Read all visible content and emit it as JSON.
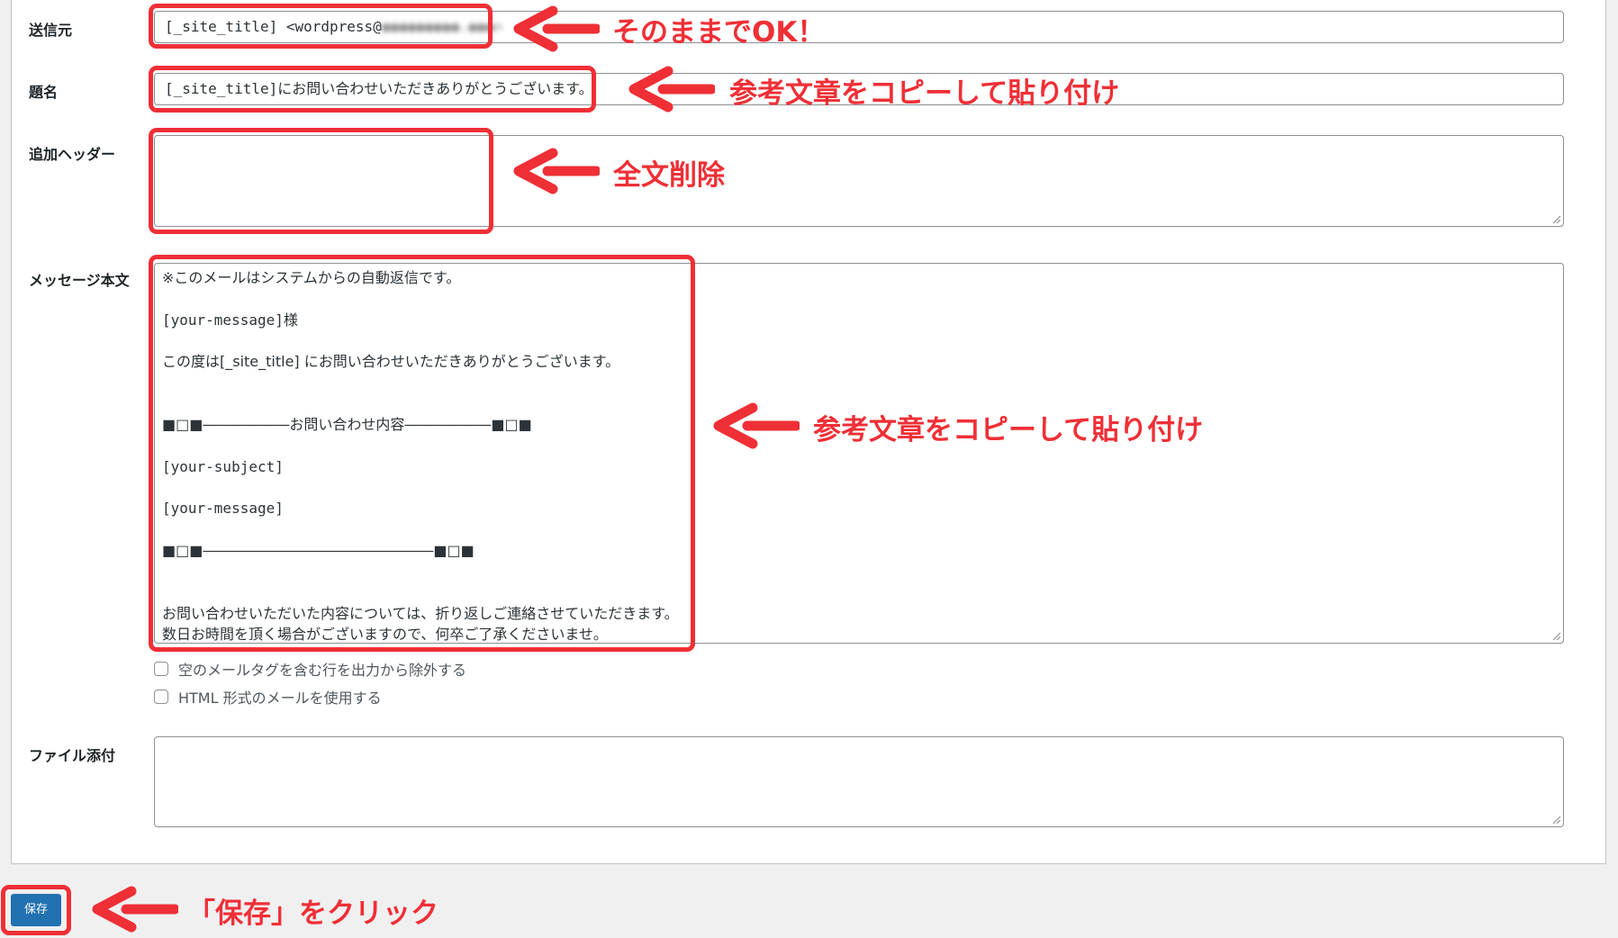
{
  "form": {
    "sender": {
      "label": "送信元",
      "value_prefix": "[_site_title] <wordpress@"
    },
    "subject": {
      "label": "題名",
      "tag": "[_site_title]",
      "text": "にお問い合わせいただきありがとうございます。"
    },
    "headers": {
      "label": "追加ヘッダー",
      "value": ""
    },
    "body": {
      "label": "メッセージ本文",
      "lines": [
        "※このメールはシステムからの自動返信です。",
        "",
        "[your-message]様",
        "",
        "この度は[_site_title] にお問い合わせいただきありがとうございます。",
        "",
        "",
        "■□■――――――お問い合わせ内容――――――■□■",
        "",
        "[your-subject]",
        "",
        "[your-message]",
        "",
        "■□■――――――――――――――――■□■",
        "",
        "",
        "お問い合わせいただいた内容については、折り返しご連絡させていただきます。",
        "数日お時間を頂く場合がございますので、何卒ご了承くださいませ。"
      ]
    },
    "exclude_blank": {
      "label": "空のメールタグを含む行を出力から除外する",
      "checked": false
    },
    "use_html": {
      "label": "HTML 形式のメールを使用する",
      "checked": false
    },
    "attachments": {
      "label": "ファイル添付",
      "value": ""
    },
    "save_label": "保存"
  },
  "annotations": {
    "sender_note": "そのままでOK！",
    "subject_note": "参考文章をコピーして貼り付け",
    "headers_note": "全文削除",
    "body_note": "参考文章をコピーして貼り付け",
    "save_note": "「保存」をクリック",
    "color": "#ef2f36"
  },
  "theme": {
    "primary_button": "#2271b1",
    "border": "#8c8f94"
  }
}
